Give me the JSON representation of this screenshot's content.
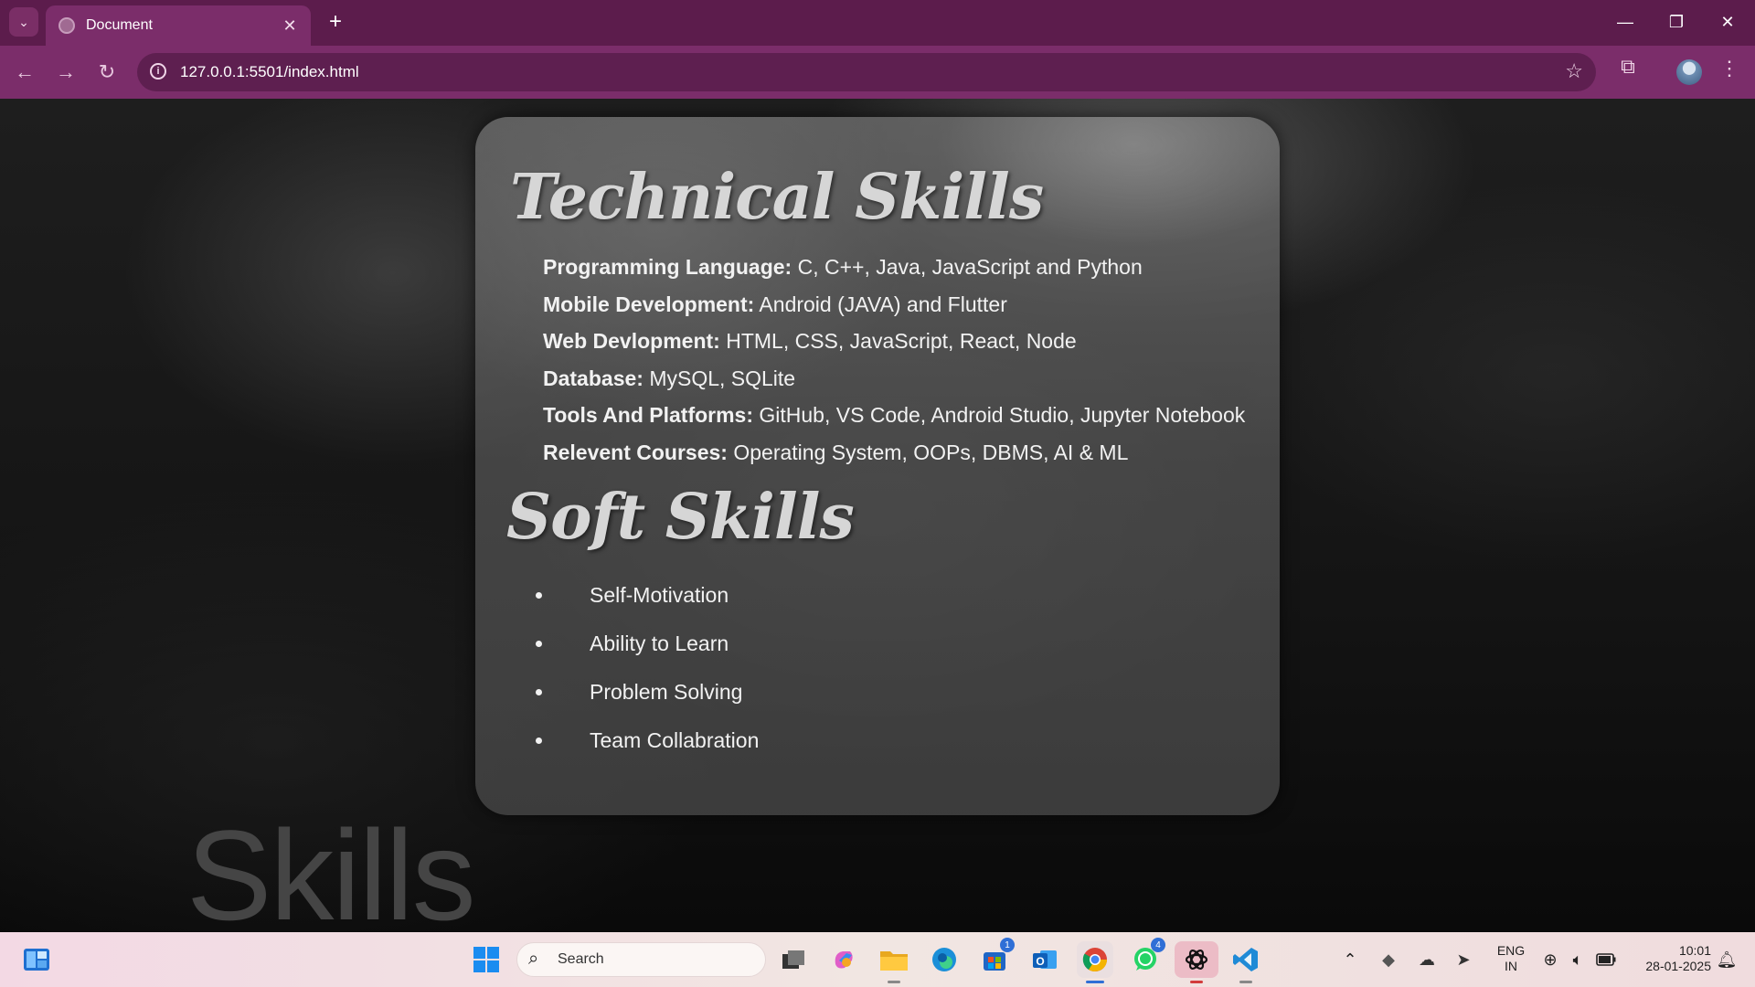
{
  "browser": {
    "tab_title": "Document",
    "tab_close": "✕",
    "new_tab": "+",
    "url": "127.0.0.1:5501/index.html",
    "icons": [
      "tab-search-icon",
      "back-icon",
      "forward-icon",
      "reload-icon",
      "site-info-icon",
      "bookmark-star-icon",
      "extensions-icon",
      "profile-avatar",
      "more-menu-icon",
      "minimize-icon",
      "restore-icon",
      "close-window-icon"
    ]
  },
  "page": {
    "technical_title": "Technical Skills",
    "technical": [
      {
        "label": "Programming Language:",
        "value": " C, C++, Java, JavaScript and Python"
      },
      {
        "label": "Mobile Development:",
        "value": " Android (JAVA) and Flutter"
      },
      {
        "label": "Web Devlopment:",
        "value": " HTML, CSS, JavaScript, React, Node"
      },
      {
        "label": "Database:",
        "value": " MySQL, SQLite"
      },
      {
        "label": "Tools And Platforms:",
        "value": " GitHub, VS Code, Android Studio, Jupyter Notebook"
      },
      {
        "label": "Relevent Courses:",
        "value": " Operating System, OOPs, DBMS, AI & ML"
      }
    ],
    "soft_title": "Soft Skills",
    "soft": [
      "Self-Motivation",
      "Ability to Learn",
      "Problem Solving",
      "Team Collabration"
    ],
    "background_heading": "Skills"
  },
  "taskbar": {
    "search_placeholder": "Search",
    "store_badge": "1",
    "whatsapp_badge": "4",
    "language": "ENG",
    "region": "IN",
    "time": "10:01",
    "date": "28-01-2025"
  }
}
